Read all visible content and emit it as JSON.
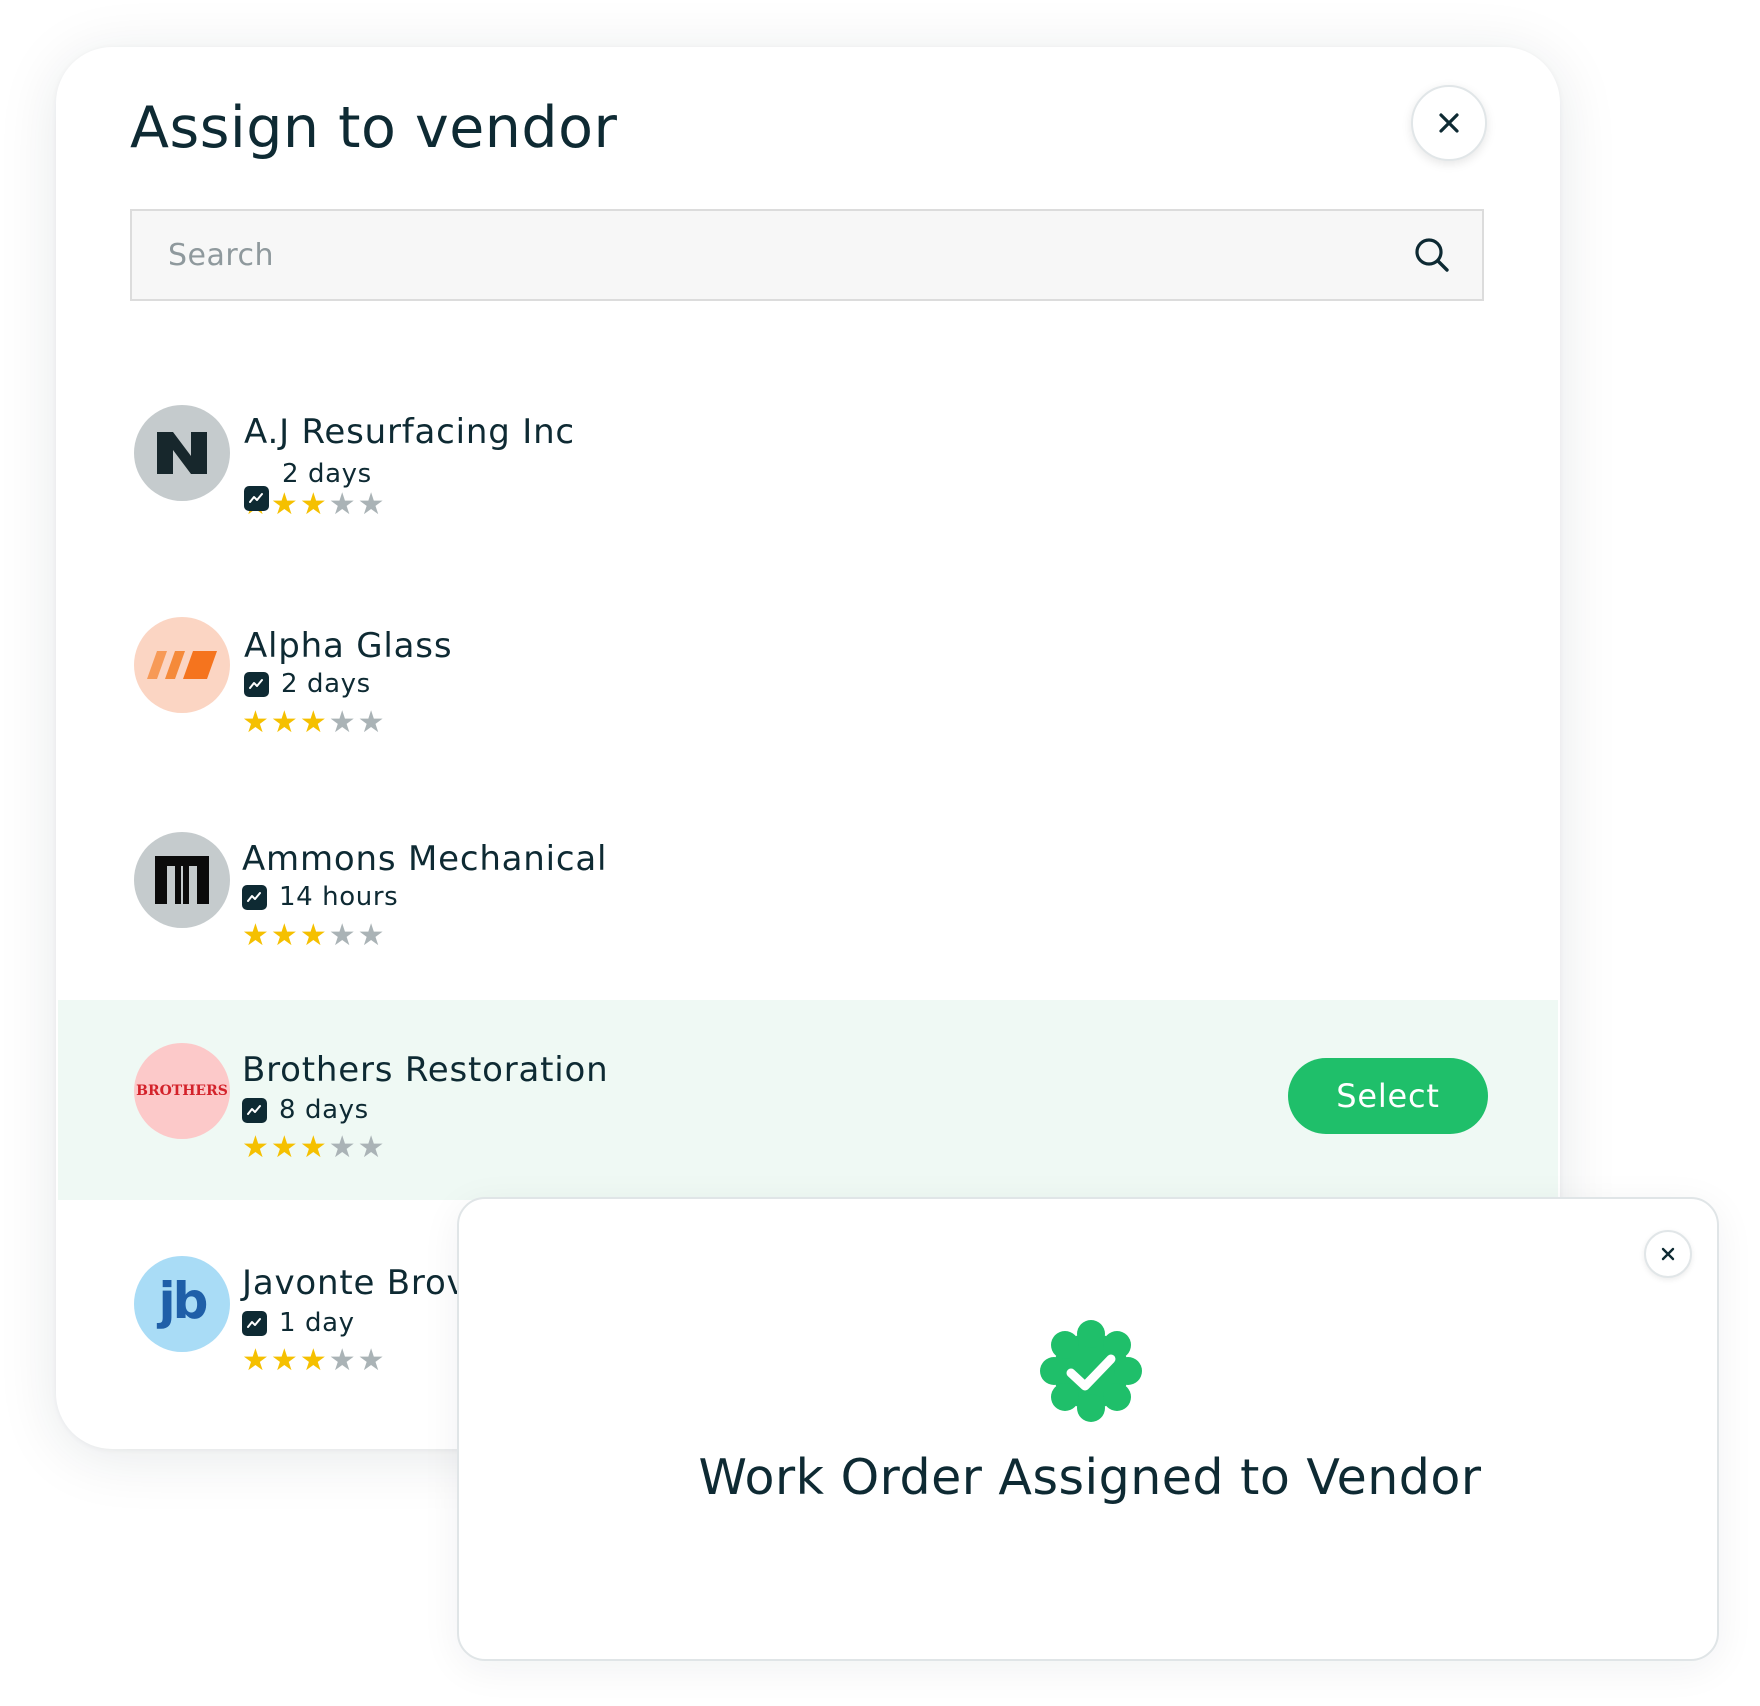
{
  "modal": {
    "title": "Assign to vendor",
    "close_icon": "close-icon",
    "search": {
      "placeholder": "Search",
      "value": "",
      "icon": "search-icon"
    }
  },
  "vendors": [
    {
      "name": "A.J Resurfacing Inc",
      "response_time": "2 days",
      "rating": 3,
      "rating_max": 5,
      "logo": "n-logo"
    },
    {
      "name": "Alpha Glass",
      "response_time": "2 days",
      "rating": 3,
      "rating_max": 5,
      "logo": "stripes-logo"
    },
    {
      "name": "Ammons Mechanical",
      "response_time": "14 hours",
      "rating": 3,
      "rating_max": 5,
      "logo": "m-logo"
    },
    {
      "name": "Brothers Restoration",
      "response_time": "8 days",
      "rating": 3,
      "rating_max": 5,
      "logo": "brothers-logo",
      "logo_text": "BROTHERS",
      "highlighted": true
    },
    {
      "name": "Javonte Brov",
      "response_time": "1 day",
      "rating": 3,
      "rating_max": 5,
      "logo": "jb-logo",
      "logo_text": "jb"
    }
  ],
  "select_button": {
    "label": "Select"
  },
  "toast": {
    "message": "Work Order Assigned to Vendor",
    "icon": "check-badge-icon",
    "close_icon": "close-icon"
  },
  "colors": {
    "accent": "#1fbf6a",
    "text": "#0e2a33",
    "highlight_row": "#eff9f4",
    "star_on": "#f5c000",
    "star_off": "#aab3b6"
  }
}
